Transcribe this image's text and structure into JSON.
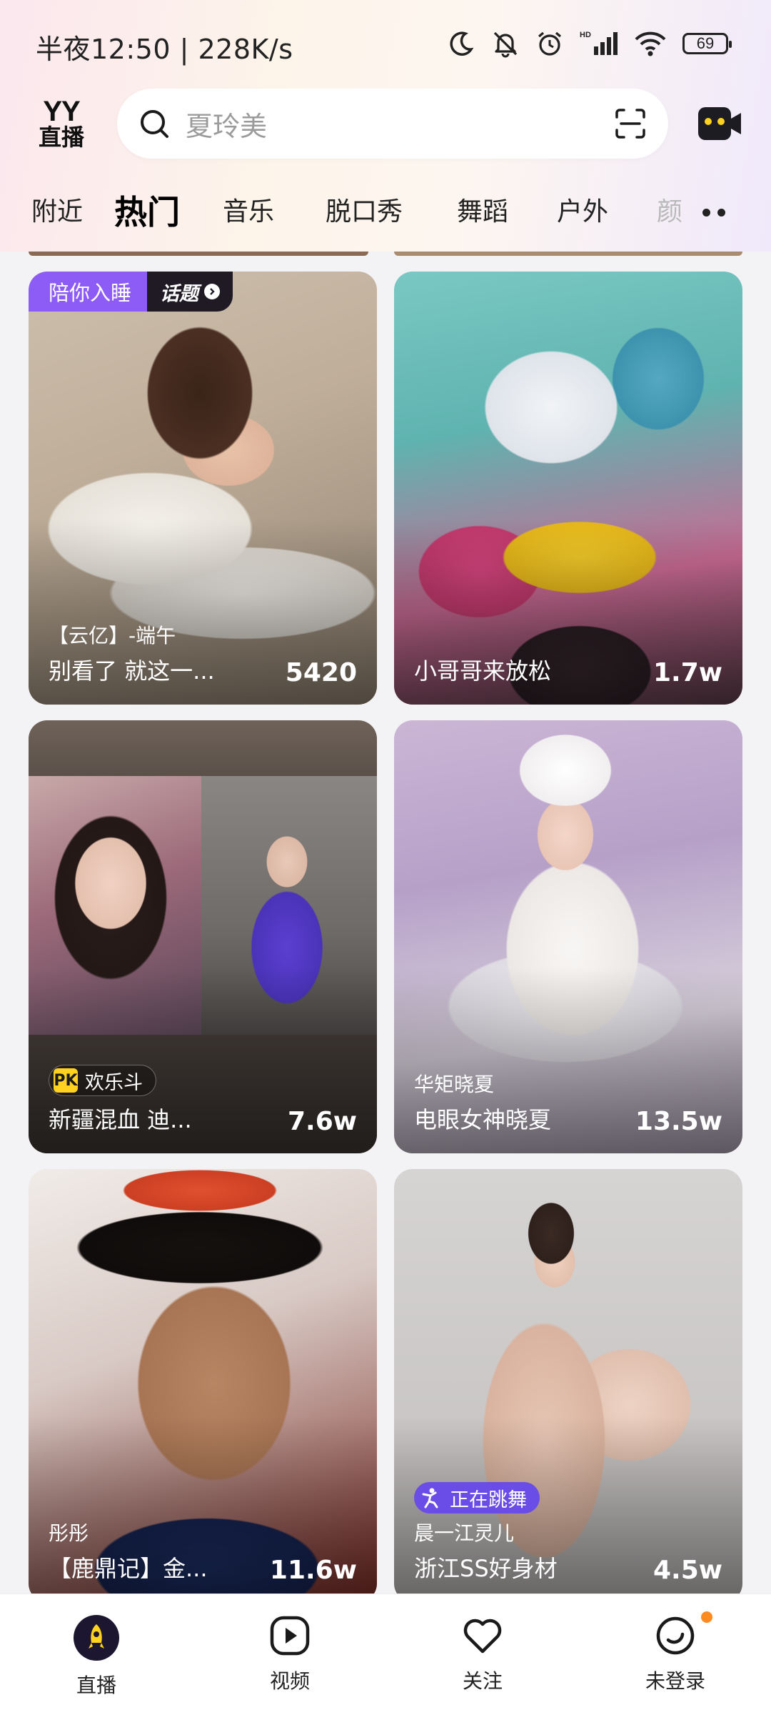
{
  "status_bar": {
    "time": "半夜12:50 | 228K/s",
    "battery": "69"
  },
  "header": {
    "logo_top": "YY",
    "logo_bottom": "直播",
    "search_placeholder": "夏玲美"
  },
  "tabs": [
    {
      "label": "附近"
    },
    {
      "label": "热门"
    },
    {
      "label": "音乐"
    },
    {
      "label": "脱口秀"
    },
    {
      "label": "舞蹈"
    },
    {
      "label": "户外"
    },
    {
      "label": "颜"
    }
  ],
  "cards": [
    {
      "topic_tag": "陪你入睡",
      "topic_link": "话题",
      "subtitle": "【云亿】-端午",
      "title": "别看了 就这一...",
      "count": "5420"
    },
    {
      "subtitle": "",
      "title": "小哥哥来放松",
      "count": "1.7w"
    },
    {
      "badge": "欢乐斗",
      "title": "新疆混血 迪...",
      "count": "7.6w"
    },
    {
      "subtitle": "华矩晓夏",
      "title": "电眼女神晓夏",
      "count": "13.5w"
    },
    {
      "subtitle": "彤彤",
      "title": "【鹿鼎记】金...",
      "count": "11.6w"
    },
    {
      "badge": "正在跳舞",
      "subtitle": "晨一江灵儿",
      "title": "浙江SS好身材",
      "count": "4.5w"
    }
  ],
  "bottom_nav": [
    {
      "label": "直播"
    },
    {
      "label": "视频"
    },
    {
      "label": "关注"
    },
    {
      "label": "未登录"
    }
  ],
  "colors": {
    "accent_purple": "#8d5cf6",
    "nav_active_yellow": "#ffd21f",
    "notification_dot": "#ff8a1f"
  }
}
